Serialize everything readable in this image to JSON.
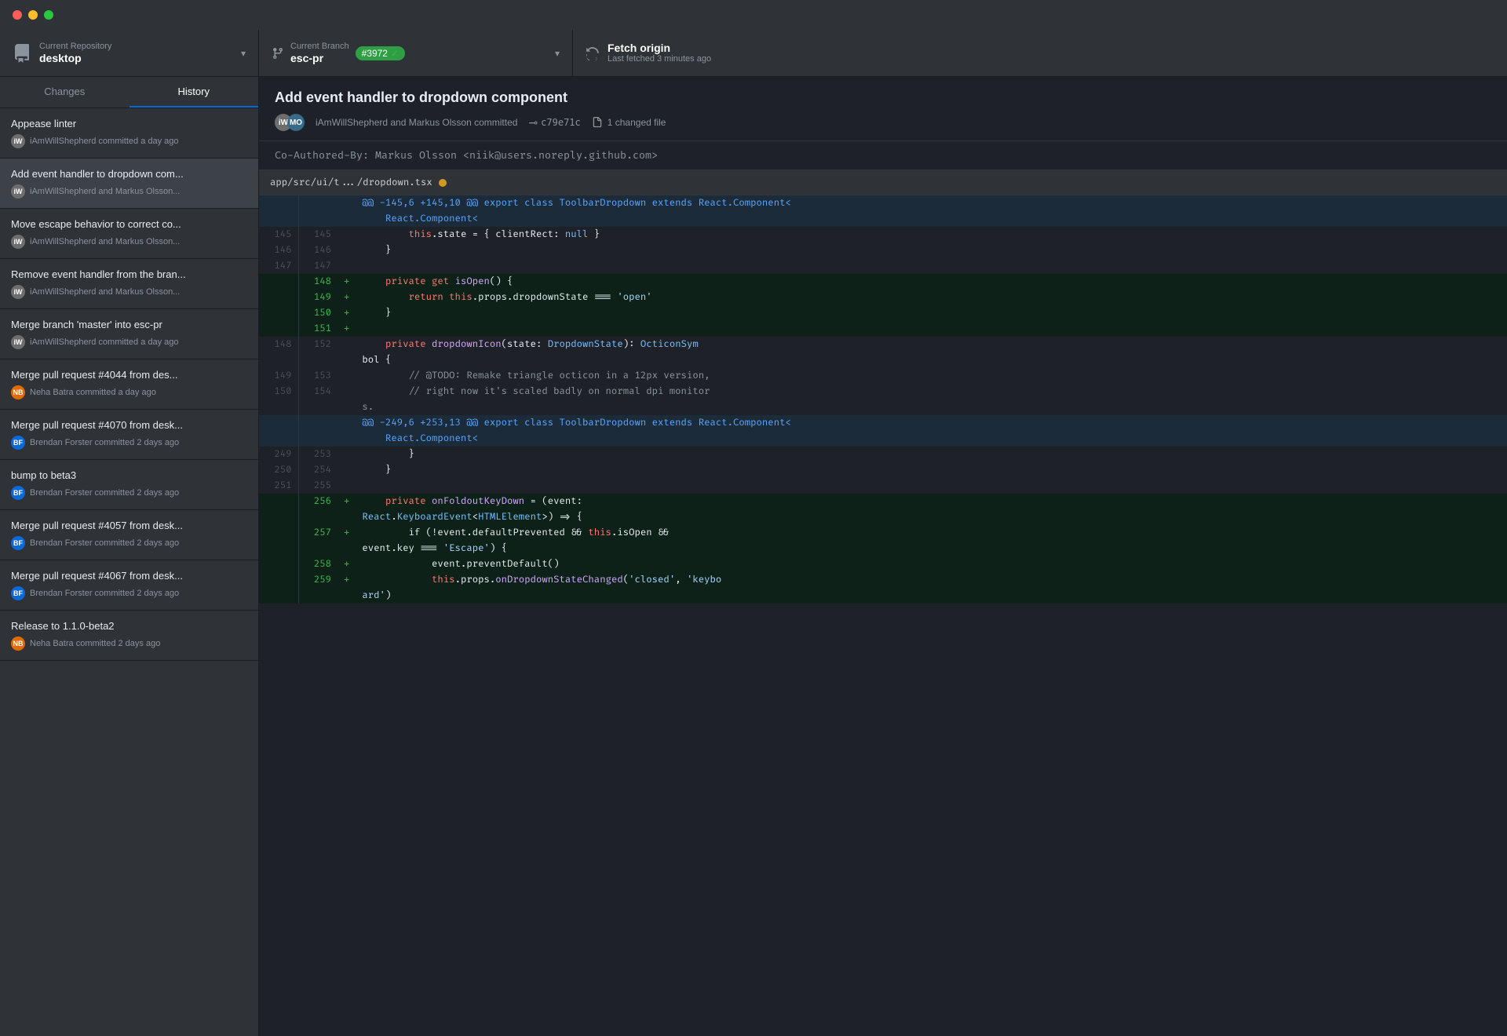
{
  "titlebar": {
    "traffic_lights": [
      "red",
      "yellow",
      "green"
    ]
  },
  "toolbar": {
    "repo": {
      "label_small": "Current Repository",
      "label_large": "desktop"
    },
    "branch": {
      "label_small": "Current Branch",
      "label_large": "esc-pr",
      "badge": "#3972",
      "badge_check": "✓"
    },
    "fetch": {
      "label_large": "Fetch origin",
      "label_small": "Last fetched 3 minutes ago"
    }
  },
  "sidebar": {
    "tab_changes": "Changes",
    "tab_history": "History",
    "commits": [
      {
        "title": "Appease linter",
        "author": "iAmWillShepherd committed a day ago",
        "avatar_color": "#6e6e6e",
        "initials": "iW"
      },
      {
        "title": "Add event handler to dropdown com...",
        "author": "iAmWillShepherd and Markus Olsson...",
        "avatar_color": "#6e6e6e",
        "initials": "iW",
        "selected": true
      },
      {
        "title": "Move escape behavior to correct co...",
        "author": "iAmWillShepherd and Markus Olsson...",
        "avatar_color": "#6e6e6e",
        "initials": "iW"
      },
      {
        "title": "Remove event handler from the bran...",
        "author": "iAmWillShepherd and Markus Olsson...",
        "avatar_color": "#6e6e6e",
        "initials": "iW"
      },
      {
        "title": "Merge branch 'master' into esc-pr",
        "author": "iAmWillShepherd committed a day ago",
        "avatar_color": "#6e6e6e",
        "initials": "iW"
      },
      {
        "title": "Merge pull request #4044 from des...",
        "author": "Neha Batra committed a day ago",
        "avatar_color": "#e26a00",
        "initials": "NB"
      },
      {
        "title": "Merge pull request #4070 from desk...",
        "author": "Brendan Forster committed 2 days ago",
        "avatar_color": "#0969da",
        "initials": "BF"
      },
      {
        "title": "bump to beta3",
        "author": "Brendan Forster committed 2 days ago",
        "avatar_color": "#0969da",
        "initials": "BF"
      },
      {
        "title": "Merge pull request #4057 from desk...",
        "author": "Brendan Forster committed 2 days ago",
        "avatar_color": "#0969da",
        "initials": "BF"
      },
      {
        "title": "Merge pull request #4067 from desk...",
        "author": "Brendan Forster committed 2 days ago",
        "avatar_color": "#0969da",
        "initials": "BF"
      },
      {
        "title": "Release to 1.1.0-beta2",
        "author": "Neha Batra committed 2 days ago",
        "avatar_color": "#e26a00",
        "initials": "NB"
      }
    ]
  },
  "content": {
    "commit_subject": "Add event handler to dropdown component",
    "authors_text": "iAmWillShepherd and Markus Olsson committed",
    "commit_hash": "c79e71c",
    "changed_files_count": "1 changed file",
    "commit_body": "Co-Authored-By: Markus Olsson <niik@users.noreply.github.com>",
    "file_path": "app/src/ui/t.../dropdown.tsx",
    "diff_lines": [
      {
        "type": "hunk",
        "old": "",
        "new": "",
        "plus": "",
        "code": "@@ -145,6 +145,10 @@ export class ToolbarDropdown extends React.Component<"
      },
      {
        "type": "context",
        "old": "145",
        "new": "145",
        "plus": "",
        "code": "        this.state = { clientRect: null }"
      },
      {
        "type": "context",
        "old": "146",
        "new": "146",
        "plus": "",
        "code": "    }"
      },
      {
        "type": "context",
        "old": "147",
        "new": "147",
        "plus": "",
        "code": ""
      },
      {
        "type": "added",
        "old": "",
        "new": "148",
        "plus": "+",
        "code": "    private get isOpen() {"
      },
      {
        "type": "added",
        "old": "",
        "new": "149",
        "plus": "+",
        "code": "        return this.props.dropdownState === 'open'"
      },
      {
        "type": "added",
        "old": "",
        "new": "150",
        "plus": "+",
        "code": "    }"
      },
      {
        "type": "added",
        "old": "",
        "new": "151",
        "plus": "+",
        "code": ""
      },
      {
        "type": "context",
        "old": "148",
        "new": "152",
        "plus": "",
        "code": "    private dropdownIcon(state: DropdownState): OcticonSymbol {"
      },
      {
        "type": "context",
        "old": "149",
        "new": "153",
        "plus": "",
        "code": "        // @TODO: Remake triangle octicon in a 12px version,"
      },
      {
        "type": "context",
        "old": "150",
        "new": "154",
        "plus": "",
        "code": "        // right now it's scaled badly on normal dpi monitors."
      },
      {
        "type": "hunk",
        "old": "",
        "new": "",
        "plus": "",
        "code": "@@ -249,6 +253,13 @@ export class ToolbarDropdown extends React.Component<"
      },
      {
        "type": "context2",
        "old": "",
        "new": "",
        "plus": "",
        "code": "    React.Component<"
      },
      {
        "type": "context",
        "old": "249",
        "new": "253",
        "plus": "",
        "code": "        }"
      },
      {
        "type": "context",
        "old": "250",
        "new": "254",
        "plus": "",
        "code": "    }"
      },
      {
        "type": "context",
        "old": "251",
        "new": "255",
        "plus": "",
        "code": ""
      },
      {
        "type": "added",
        "old": "",
        "new": "256",
        "plus": "+",
        "code": "    private onFoldoutKeyDown = (event:"
      },
      {
        "type": "added_cont",
        "old": "",
        "new": "",
        "plus": "",
        "code": "React.KeyboardEvent<HTMLElement>) => {"
      },
      {
        "type": "added",
        "old": "",
        "new": "257",
        "plus": "+",
        "code": "        if (!event.defaultPrevented && this.isOpen &&"
      },
      {
        "type": "added_cont2",
        "old": "",
        "new": "",
        "plus": "",
        "code": "event.key === 'Escape') {"
      },
      {
        "type": "added",
        "old": "",
        "new": "258",
        "plus": "+",
        "code": "            event.preventDefault()"
      },
      {
        "type": "added",
        "old": "",
        "new": "259",
        "plus": "+",
        "code": "            this.props.onDropdownStateChanged('closed', 'keybo"
      }
    ]
  }
}
